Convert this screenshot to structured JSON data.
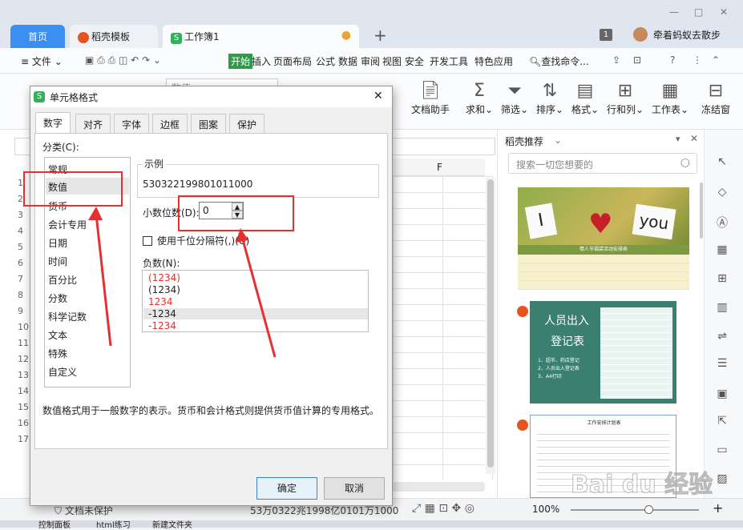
{
  "window": {
    "tabs": [
      "首页",
      "稻壳模板",
      "工作簿1"
    ],
    "page_indicator": "1",
    "user_name": "牵着蚂蚁去散步",
    "controls": [
      "—",
      "□",
      "✕"
    ]
  },
  "menubar": {
    "file_label": "文件",
    "items": [
      "开始",
      "插入",
      "页面布局",
      "公式",
      "数据",
      "审阅",
      "视图",
      "安全",
      "开发工具",
      "特色应用"
    ],
    "active": "开始",
    "search_label": "查找命令..."
  },
  "ribbon": {
    "font_value": "数值",
    "buttons": [
      "文档助手",
      "求和",
      "筛选",
      "排序",
      "格式",
      "行和列",
      "工作表",
      "冻结窗"
    ]
  },
  "sheet": {
    "column_letter": "F",
    "row_numbers": [
      "1",
      "2",
      "3",
      "4",
      "5",
      "6",
      "7",
      "8",
      "9",
      "10",
      "11",
      "12",
      "13",
      "14",
      "15",
      "16",
      "17"
    ],
    "sheet_protect_label": "文档未保护",
    "status_value": "53万0322兆1998亿0101万1000"
  },
  "pane": {
    "title": "稻壳推荐",
    "search_placeholder": "搜索一切您想要的",
    "card1": {
      "words": [
        "I",
        "you"
      ],
      "table_title": "情人节福袋活动安排表"
    },
    "card2": {
      "title_line1": "人员出入",
      "title_line2": "登记表",
      "bullets": [
        "1、超市、药店登记",
        "2、人员出入登记表",
        "3、A4打印"
      ]
    },
    "card3": {
      "title": "工作安排计划表"
    }
  },
  "statusbar": {
    "zoom": "100%"
  },
  "taskbar": {
    "items": [
      "控制面板",
      "html练习",
      "新建文件夹"
    ]
  },
  "dialog": {
    "title": "单元格格式",
    "tabs": [
      "数字",
      "对齐",
      "字体",
      "边框",
      "图案",
      "保护"
    ],
    "category_label": "分类(C):",
    "categories": [
      "常规",
      "数值",
      "货币",
      "会计专用",
      "日期",
      "时间",
      "百分比",
      "分数",
      "科学记数",
      "文本",
      "特殊",
      "自定义"
    ],
    "selected_category": "数值",
    "sample_label": "示例",
    "sample_value": "530322199801011000",
    "decimal_label": "小数位数(D):",
    "decimal_value": "0",
    "thousands_label": "使用千位分隔符(,)(U)",
    "negative_label": "负数(N):",
    "negatives": [
      "(1234)",
      "(1234)",
      "1234",
      "-1234",
      "-1234"
    ],
    "description": "数值格式用于一般数字的表示。货币和会计格式则提供货币值计算的专用格式。",
    "ok_label": "确定",
    "cancel_label": "取消"
  },
  "colors": {
    "accent_green": "#2e9a4a",
    "tab_blue": "#3b8ff0",
    "annotation_red": "#e53030",
    "card_teal": "#3b7f71"
  },
  "watermark": "Bai du 经验"
}
